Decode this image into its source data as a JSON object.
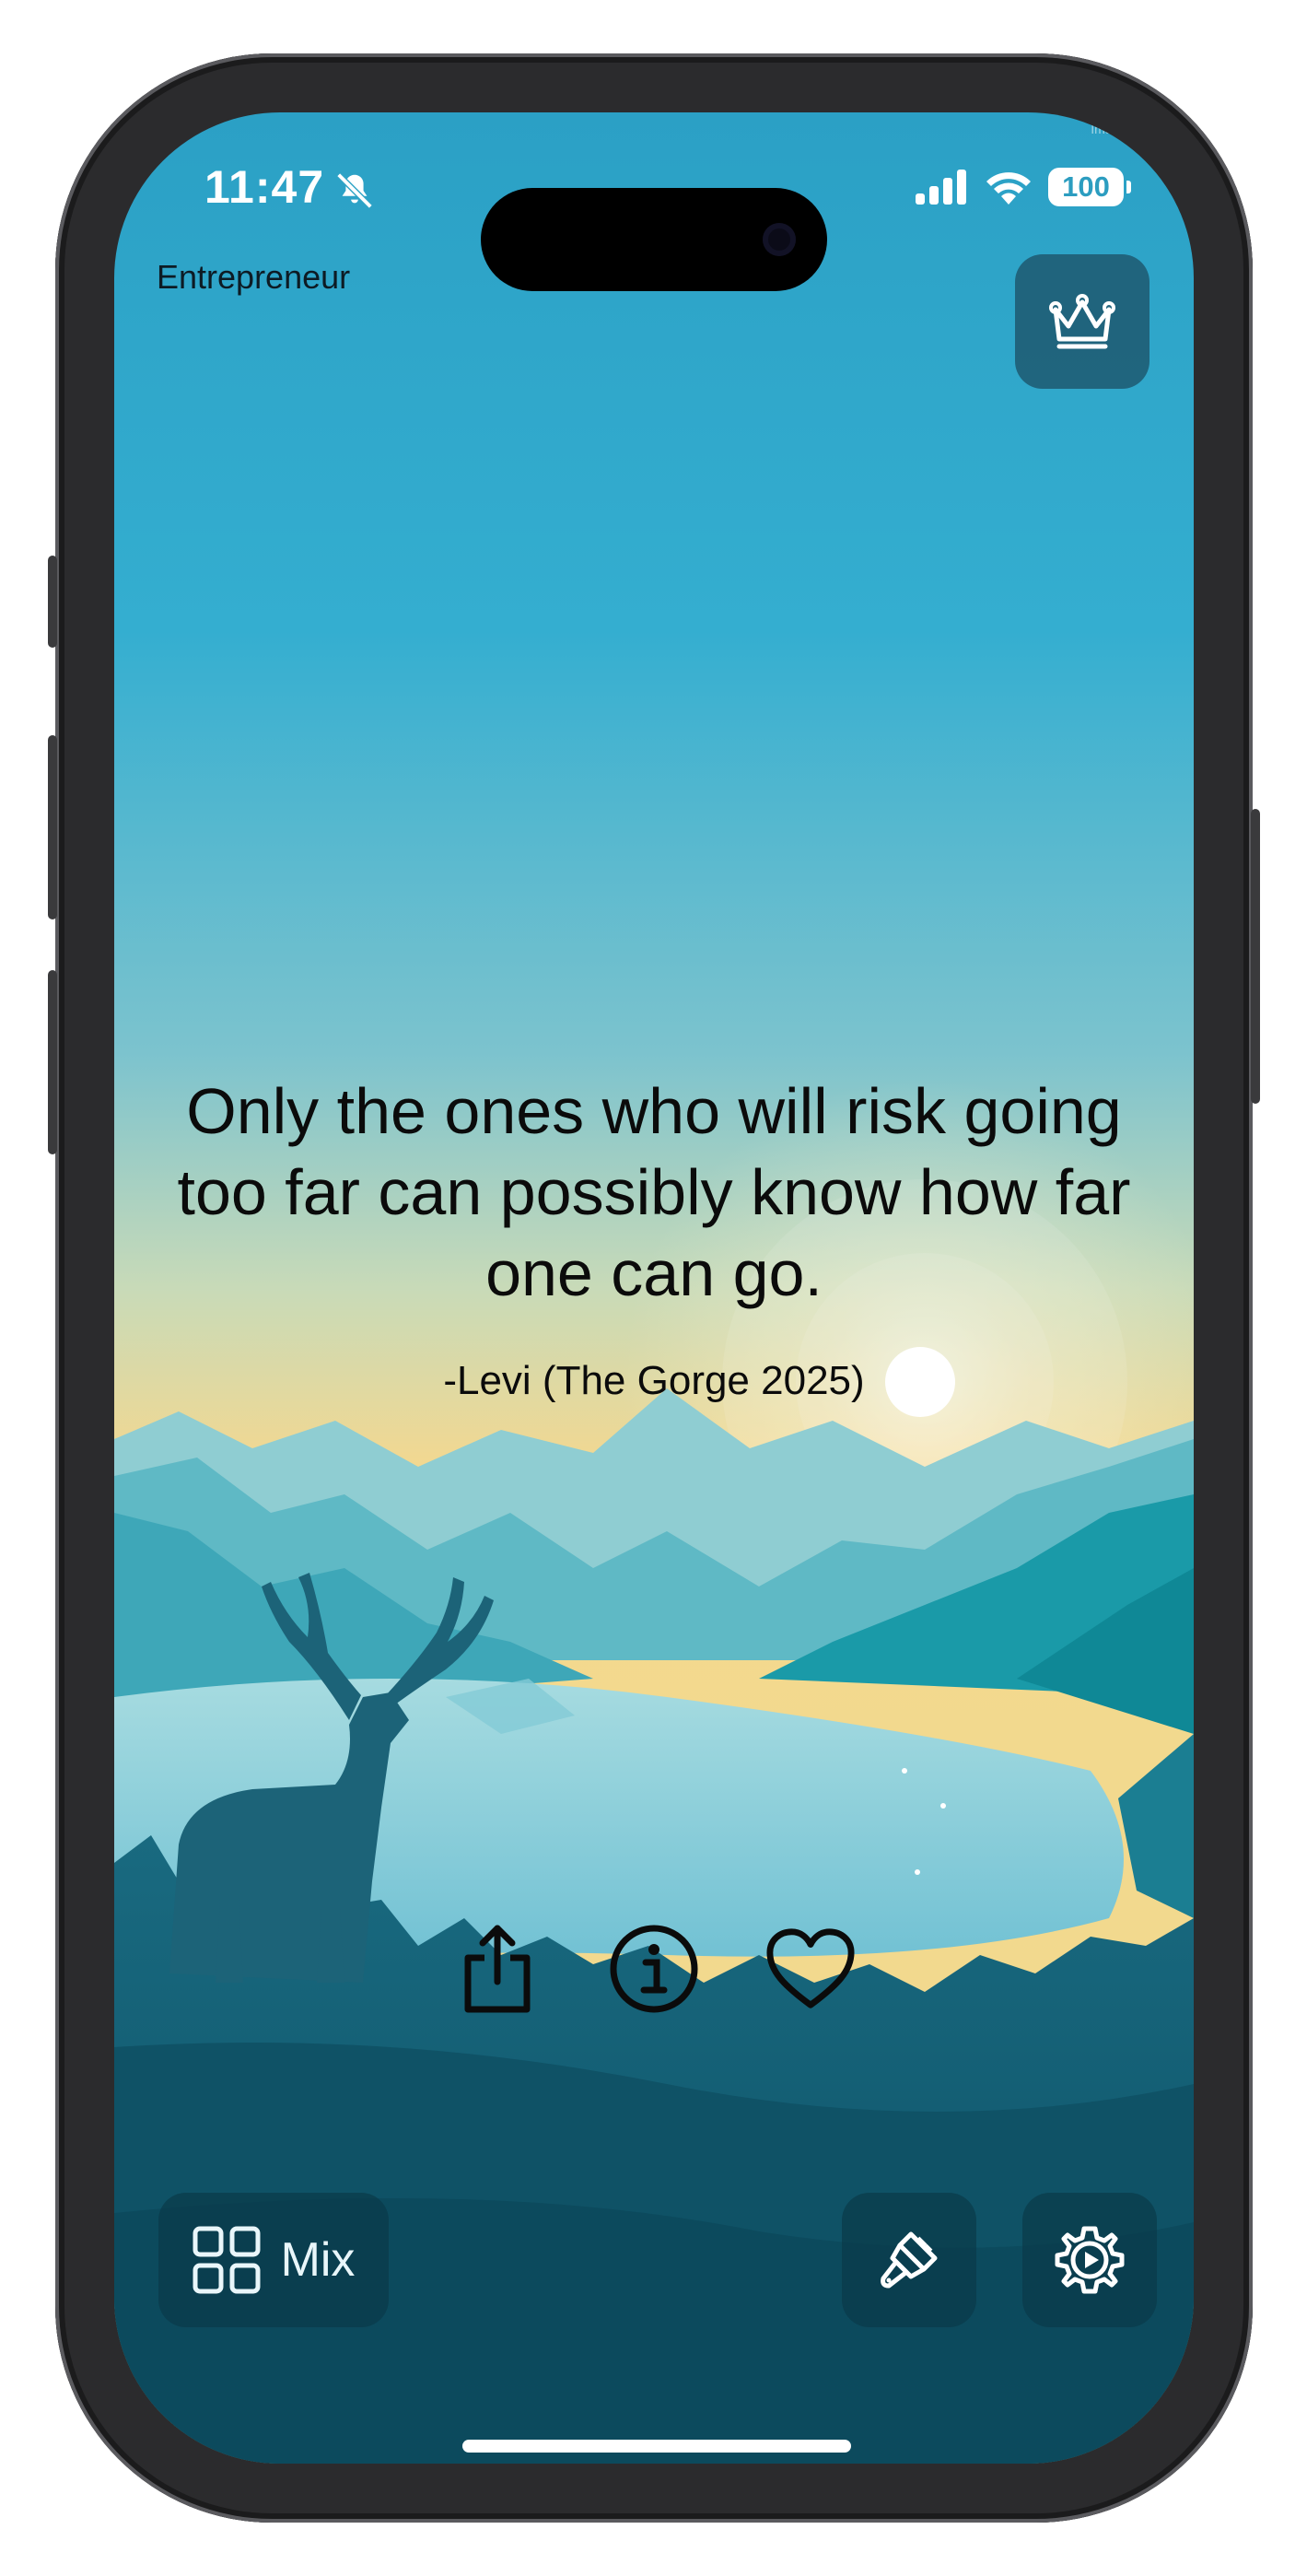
{
  "status_bar": {
    "time": "11:47",
    "battery": "100",
    "icons": [
      "bell-slash-icon",
      "cellular-signal-icon",
      "wifi-icon",
      "battery-icon"
    ]
  },
  "header": {
    "category": "Entrepreneur",
    "watermark": "Image lu"
  },
  "quote": {
    "text": "Only the ones who will risk going too far can possibly know how far one can go.",
    "author": "-Levi (The Gorge 2025)"
  },
  "actions": {
    "icons": [
      "share-icon",
      "info-icon",
      "heart-icon"
    ]
  },
  "bottom_bar": {
    "mix_label": "Mix",
    "icons": [
      "grid-icon",
      "paintbrush-icon",
      "gear-icon"
    ]
  },
  "colors": {
    "sky_top": "#2fa6c8",
    "sky_horizon": "#f5d78c",
    "ground": "#0f5a6e",
    "button_bg": "#0a3a4a",
    "text": "#0b0b0b"
  }
}
